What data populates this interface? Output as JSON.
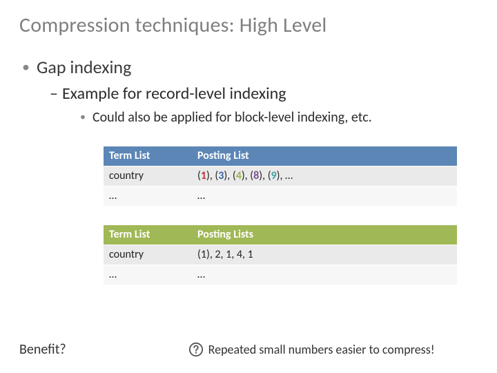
{
  "title": "Compression techniques: High Level",
  "bullets": {
    "b1": "Gap indexing",
    "b2": "Example for record-level indexing",
    "b3": "Could also be applied for block-level indexing, etc."
  },
  "table1": {
    "headers": {
      "term": "Term List",
      "posting": "Posting List"
    },
    "rows": [
      {
        "term": "country",
        "posting_raw": "(1), (3), (4), (8), (9), …",
        "posting_values": [
          1,
          3,
          4,
          8,
          9
        ]
      },
      {
        "term": "…",
        "posting_raw": "…"
      }
    ],
    "header_color": "#5b86b6"
  },
  "table2": {
    "headers": {
      "term": "Term List",
      "posting": "Posting Lists"
    },
    "rows": [
      {
        "term": "country",
        "posting_raw": "(1), 2, 1, 4, 1",
        "posting_values": [
          1,
          2,
          1,
          4,
          1
        ]
      },
      {
        "term": "…",
        "posting_raw": "…"
      }
    ],
    "header_color": "#a0b856"
  },
  "footer": {
    "question": "Benefit?",
    "answer": "Repeated small numbers easier to compress!"
  },
  "highlight_colors": [
    "#bf3131",
    "#3d67a6",
    "#9bb247",
    "#7a5196",
    "#3e9c9c"
  ]
}
